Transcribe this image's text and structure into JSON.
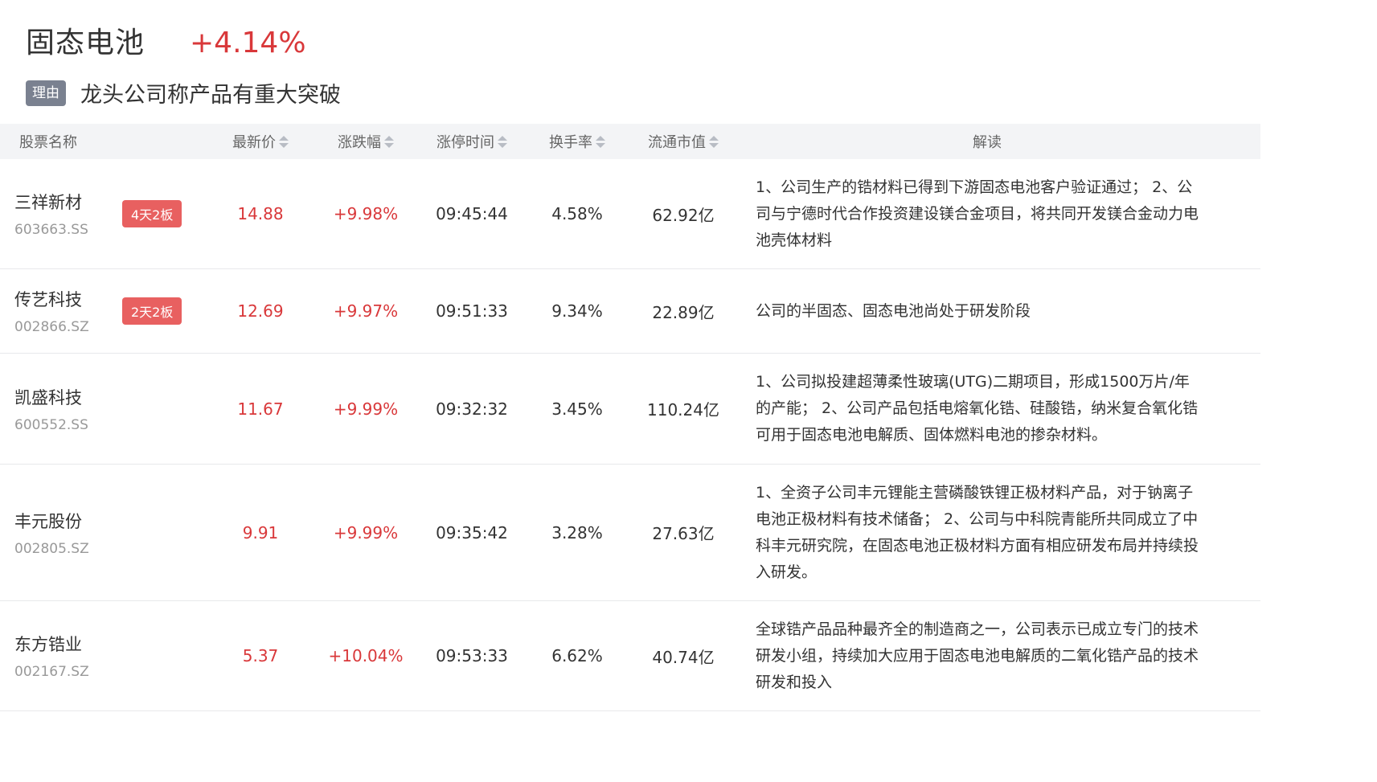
{
  "sector": {
    "name": "固态电池",
    "change": "+4.14%",
    "reason_tag": "理由",
    "reason": "龙头公司称产品有重大突破"
  },
  "columns": {
    "name": "股票名称",
    "price": "最新价",
    "change": "涨跌幅",
    "limit_time": "涨停时间",
    "turnover": "换手率",
    "market_cap": "流通市值",
    "analysis": "解读"
  },
  "rows": [
    {
      "name": "三祥新材",
      "code": "603663.SS",
      "badge": "4天2板",
      "price": "14.88",
      "change": "+9.98%",
      "limit_time": "09:45:44",
      "turnover": "4.58%",
      "market_cap": "62.92亿",
      "analysis": "1、公司生产的锆材料已得到下游固态电池客户验证通过； 2、公司与宁德时代合作投资建设镁合金项目，将共同开发镁合金动力电池壳体材料"
    },
    {
      "name": "传艺科技",
      "code": "002866.SZ",
      "badge": "2天2板",
      "price": "12.69",
      "change": "+9.97%",
      "limit_time": "09:51:33",
      "turnover": "9.34%",
      "market_cap": "22.89亿",
      "analysis": "公司的半固态、固态电池尚处于研发阶段"
    },
    {
      "name": "凯盛科技",
      "code": "600552.SS",
      "badge": "",
      "price": "11.67",
      "change": "+9.99%",
      "limit_time": "09:32:32",
      "turnover": "3.45%",
      "market_cap": "110.24亿",
      "analysis": "1、公司拟投建超薄柔性玻璃(UTG)二期项目，形成1500万片/年的产能； 2、公司产品包括电熔氧化锆、硅酸锆，纳米复合氧化锆可用于固态电池电解质、固体燃料电池的掺杂材料。"
    },
    {
      "name": "丰元股份",
      "code": "002805.SZ",
      "badge": "",
      "price": "9.91",
      "change": "+9.99%",
      "limit_time": "09:35:42",
      "turnover": "3.28%",
      "market_cap": "27.63亿",
      "analysis": "1、全资子公司丰元锂能主营磷酸铁锂正极材料产品，对于钠离子电池正极材料有技术储备； 2、公司与中科院青能所共同成立了中科丰元研究院，在固态电池正极材料方面有相应研发布局并持续投入研发。"
    },
    {
      "name": "东方锆业",
      "code": "002167.SZ",
      "badge": "",
      "price": "5.37",
      "change": "+10.04%",
      "limit_time": "09:53:33",
      "turnover": "6.62%",
      "market_cap": "40.74亿",
      "analysis": "全球锆产品品种最齐全的制造商之一，公司表示已成立专门的技术研发小组，持续加大应用于固态电池电解质的二氧化锆产品的技术研发和投入"
    }
  ]
}
